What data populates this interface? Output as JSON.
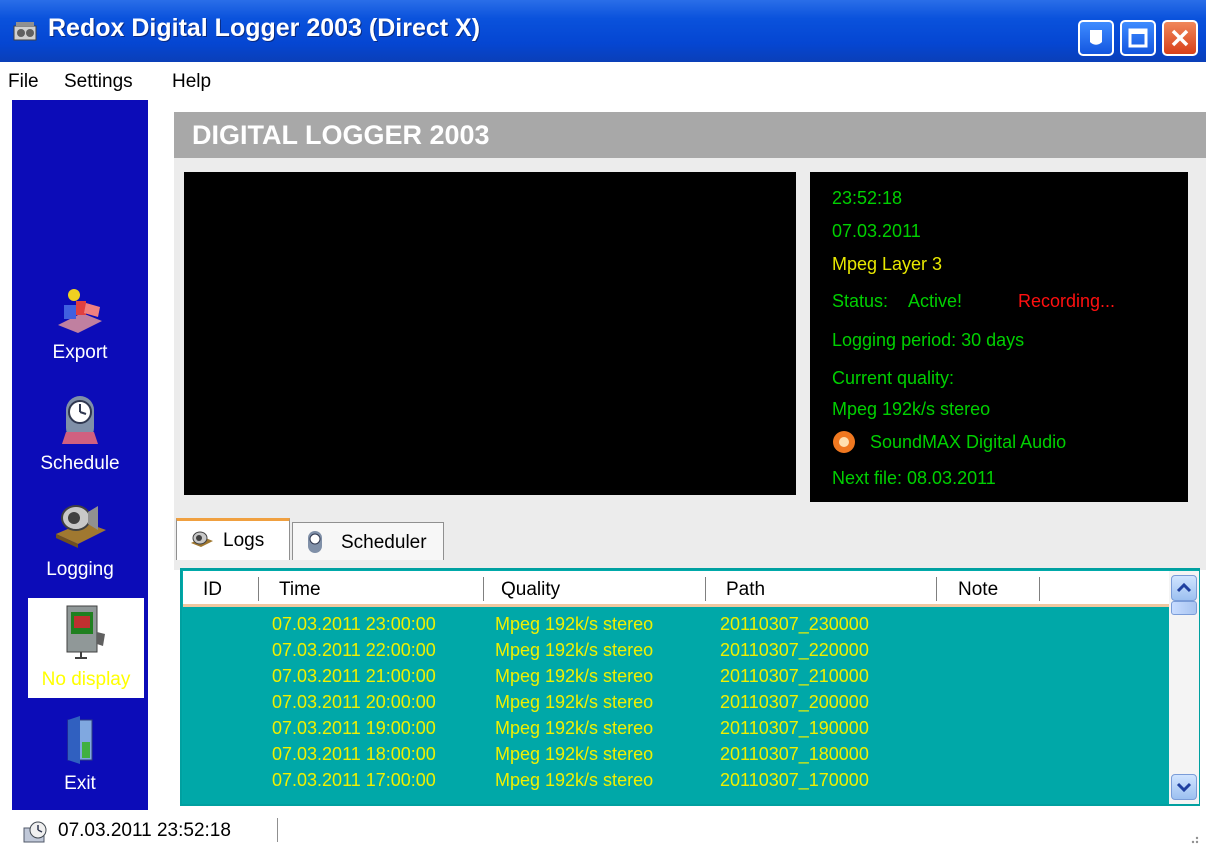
{
  "window": {
    "title": "Redox Digital Logger 2003 (Direct X)"
  },
  "menu": {
    "items": [
      "File",
      "Settings",
      "Help"
    ]
  },
  "sidebar": {
    "items": [
      {
        "label": "Export",
        "icon": "export-icon"
      },
      {
        "label": "Schedule",
        "icon": "clock-icon"
      },
      {
        "label": "Logging",
        "icon": "speaker-icon"
      },
      {
        "label": "No display",
        "icon": "monitor-icon",
        "active": true
      },
      {
        "label": "Exit",
        "icon": "door-icon"
      }
    ]
  },
  "main": {
    "title": "DIGITAL LOGGER 2003"
  },
  "info": {
    "time": "23:52:18",
    "date": "07.03.2011",
    "codec": "Mpeg Layer 3",
    "status_label": "Status:",
    "status_value": "Active!",
    "recording": "Recording...",
    "logging_period": "Logging period: 30 days",
    "quality_label": "Current quality:",
    "quality_value": "Mpeg 192k/s stereo",
    "device": "SoundMAX Digital Audio",
    "next_file": "Next file:  08.03.2011"
  },
  "tabs": [
    {
      "label": "Logs",
      "active": true
    },
    {
      "label": "Scheduler",
      "active": false
    }
  ],
  "log_table": {
    "columns": [
      "ID",
      "Time",
      "Quality",
      "Path",
      "Note"
    ],
    "rows": [
      [
        "",
        "07.03.2011 23:00:00",
        "Mpeg 192k/s stereo",
        "20110307_230000",
        ""
      ],
      [
        "",
        "07.03.2011 22:00:00",
        "Mpeg 192k/s stereo",
        "20110307_220000",
        ""
      ],
      [
        "",
        "07.03.2011 21:00:00",
        "Mpeg 192k/s stereo",
        "20110307_210000",
        ""
      ],
      [
        "",
        "07.03.2011 20:00:00",
        "Mpeg 192k/s stereo",
        "20110307_200000",
        ""
      ],
      [
        "",
        "07.03.2011 19:00:00",
        "Mpeg 192k/s stereo",
        "20110307_190000",
        ""
      ],
      [
        "",
        "07.03.2011 18:00:00",
        "Mpeg 192k/s stereo",
        "20110307_180000",
        ""
      ],
      [
        "",
        "07.03.2011 17:00:00",
        "Mpeg 192k/s stereo",
        "20110307_170000",
        ""
      ]
    ]
  },
  "status_bar": {
    "text": "07.03.2011 23:52:18"
  },
  "colors": {
    "sidebar_bg": "#0c0cb8",
    "list_bg": "#00a8a8",
    "info_green": "#00d000",
    "info_yellow": "#e8e800",
    "recording_red": "#ff1010"
  }
}
